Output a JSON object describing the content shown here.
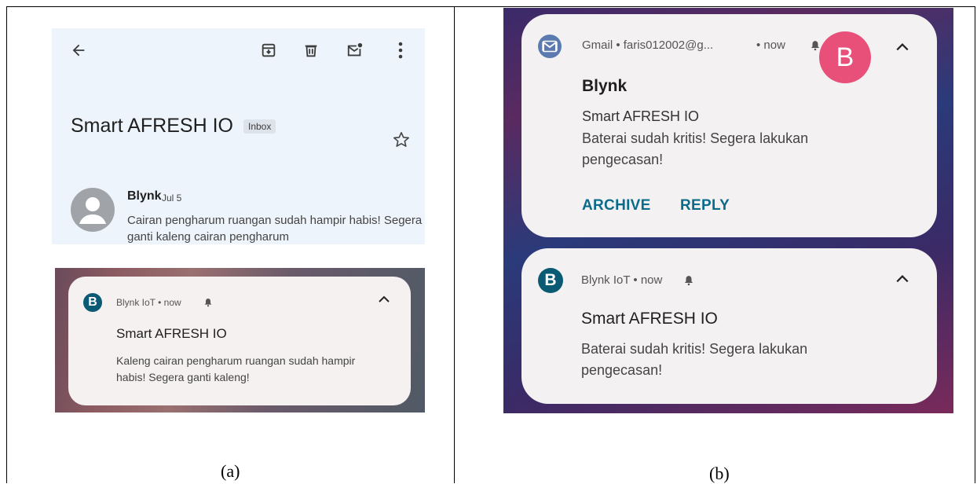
{
  "panel_a": {
    "gmail_app": {
      "toolbar": {
        "back_icon": "arrow-left-icon",
        "archive_icon": "archive-icon",
        "delete_icon": "trash-icon",
        "mark_unread_icon": "mail-unread-icon",
        "more_icon": "more-vert-icon"
      },
      "subject": "Smart AFRESH IO",
      "label_badge": "Inbox",
      "star_icon": "star-outline-icon",
      "message": {
        "sender": "Blynk",
        "date": "Jul 5",
        "snippet": "Cairan pengharum ruangan sudah hampir habis! Segera ganti kaleng cairan pengharum"
      }
    },
    "notification": {
      "app_icon_letter": "B",
      "meta": "Blynk IoT • now",
      "title": "Smart AFRESH IO",
      "body": "Kaleng cairan pengharum ruangan sudah hampir habis! Segera ganti kaleng!"
    },
    "caption": "(a)"
  },
  "panel_b": {
    "gmail_notification": {
      "meta": "Gmail • faris012002@g...",
      "time": "• now",
      "avatar_letter": "B",
      "sender": "Blynk",
      "subject": "Smart AFRESH IO",
      "body": "Baterai sudah kritis! Segera lakukan pengecasan!",
      "actions": {
        "archive": "ARCHIVE",
        "reply": "REPLY"
      }
    },
    "blynk_notification": {
      "app_icon_letter": "B",
      "meta": "Blynk IoT • now",
      "title": "Smart AFRESH IO",
      "body": "Baterai sudah kritis! Segera lakukan pengecasan!"
    },
    "caption": "(b)"
  },
  "colors": {
    "gmail_bg": "#eef4fb",
    "blynk_icon": "#0a5a73",
    "gmail_avatar": "#e8507a",
    "action_text": "#0b6b8a"
  }
}
